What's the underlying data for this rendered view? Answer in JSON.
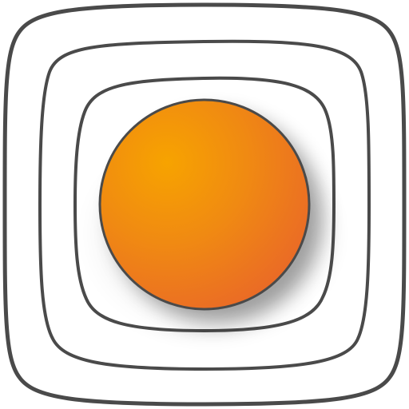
{
  "icon": {
    "name": "app-icon",
    "colors": {
      "background": "#ffffff",
      "outline": "#4a4a4a",
      "orb_highlight": "#f7a300",
      "orb_mid": "#f08a12",
      "orb_edge": "#e9642a",
      "shadow": "#000000"
    }
  }
}
